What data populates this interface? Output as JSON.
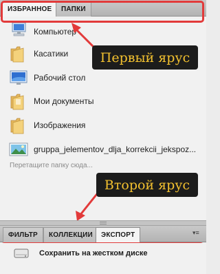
{
  "top_tabs": [
    {
      "label": "ИЗБРАННОЕ",
      "active": true
    },
    {
      "label": "ПАПКИ",
      "active": false
    }
  ],
  "favorites": [
    {
      "label": "Компьютер",
      "icon": "computer-icon"
    },
    {
      "label": "Касатики",
      "icon": "folder-icon"
    },
    {
      "label": "Рабочий стол",
      "icon": "desktop-icon"
    },
    {
      "label": "Мои документы",
      "icon": "folder-icon"
    },
    {
      "label": "Изображения",
      "icon": "folder-icon"
    },
    {
      "label": "gruppa_jelementov_dlja_korrekcii_jekspoz...",
      "icon": "image-thumbnail-icon"
    }
  ],
  "drop_hint": "Перетащите папку сюда...",
  "callouts": {
    "first_tier": "Первый ярус",
    "second_tier": "Второй ярус"
  },
  "bottom_tabs": [
    {
      "label": "ФИЛЬТР",
      "active": false
    },
    {
      "label": "КОЛЛЕКЦИИ",
      "active": false
    },
    {
      "label": "ЭКСПОРТ",
      "active": true
    }
  ],
  "export": {
    "save_label": "Сохранить на жестком диске",
    "icon": "hard-drive-icon"
  },
  "colors": {
    "annotation_red": "#e23a3a",
    "callout_bg": "#1c1c1c",
    "callout_text": "#f3c12f"
  }
}
